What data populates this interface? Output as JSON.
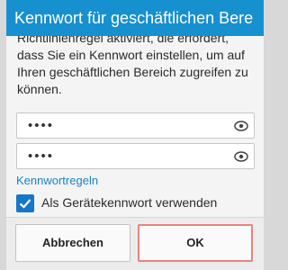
{
  "dialog": {
    "title": "Kennwort für geschäftlichen Bere",
    "message_lines": [
      "Richtlinienregel aktiviert, die erfordert,",
      "dass Sie ein Kennwort einstellen, um auf",
      "Ihren geschäftlichen Bereich zugreifen zu",
      "können."
    ],
    "password_field": {
      "value": "••••",
      "icon": "eye-icon"
    },
    "confirm_field": {
      "value": "••••",
      "icon": "eye-icon"
    },
    "rules_link": "Kennwortregeln",
    "device_password_checkbox": {
      "label": "Als Gerätekennwort verwenden",
      "checked": true
    },
    "buttons": {
      "cancel": "Abbrechen",
      "ok": "OK"
    }
  },
  "colors": {
    "title_bar": "#1690cf",
    "link": "#1684c8",
    "checkbox": "#1677c9",
    "ok_focus_border": "#e8827e"
  }
}
